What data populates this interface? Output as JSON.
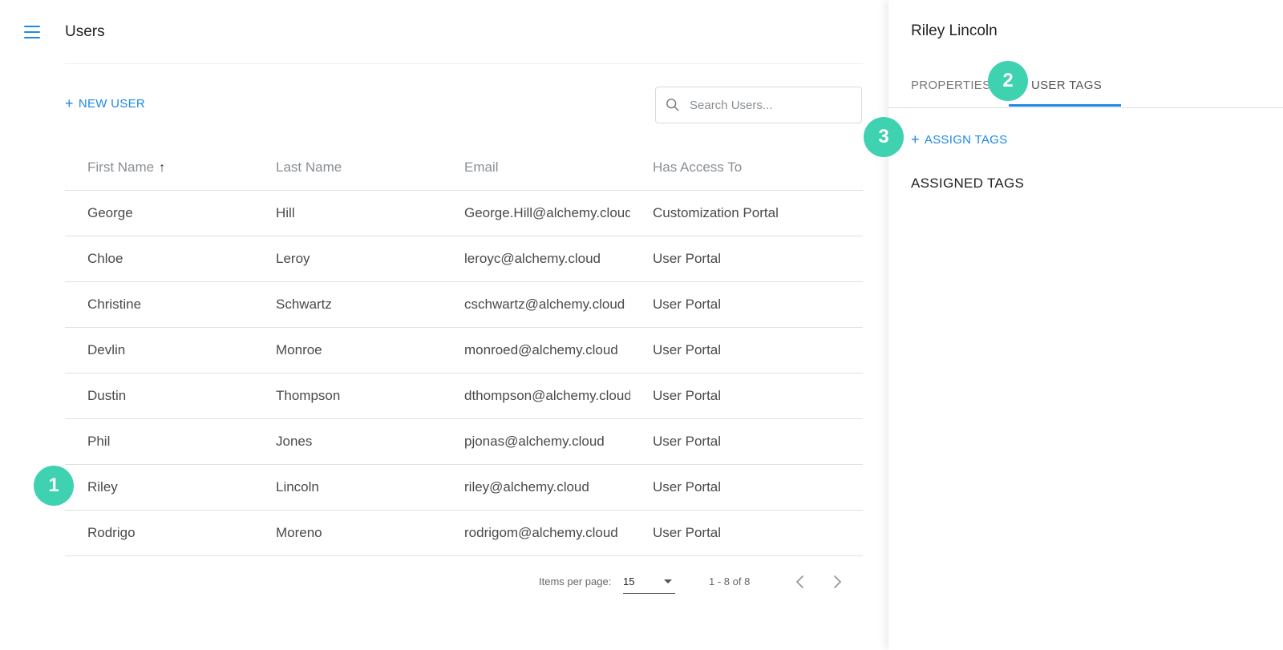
{
  "header": {
    "title": "Users"
  },
  "toolbar": {
    "new_user_label": "NEW USER",
    "search_placeholder": "Search Users..."
  },
  "table": {
    "columns": [
      "First Name",
      "Last Name",
      "Email",
      "Has Access To"
    ],
    "sorted_column": "First Name",
    "sort_direction": "ascending",
    "rows": [
      [
        "George",
        "Hill",
        "George.Hill@alchemy.cloud",
        "Customization Portal"
      ],
      [
        "Chloe",
        "Leroy",
        "leroyc@alchemy.cloud",
        "User Portal"
      ],
      [
        "Christine",
        "Schwartz",
        "cschwartz@alchemy.cloud",
        "User Portal"
      ],
      [
        "Devlin",
        "Monroe",
        "monroed@alchemy.cloud",
        "User Portal"
      ],
      [
        "Dustin",
        "Thompson",
        "dthompson@alchemy.cloud",
        "User Portal"
      ],
      [
        "Phil",
        "Jones",
        "pjonas@alchemy.cloud",
        "User Portal"
      ],
      [
        "Riley",
        "Lincoln",
        "riley@alchemy.cloud",
        "User Portal"
      ],
      [
        "Rodrigo",
        "Moreno",
        "rodrigom@alchemy.cloud",
        "User Portal"
      ]
    ]
  },
  "paginator": {
    "items_per_page_label": "Items per page:",
    "items_per_page": "15",
    "range": "1 - 8 of 8"
  },
  "panel": {
    "title": "Riley Lincoln",
    "tabs": [
      {
        "label": "PROPERTIES"
      },
      {
        "label": "USER TAGS"
      }
    ],
    "active_tab": "USER TAGS",
    "assign_tags_label": "ASSIGN TAGS",
    "assigned_tags_header": "ASSIGNED TAGS"
  },
  "annotations": [
    "1",
    "2",
    "3"
  ],
  "colors": {
    "accent": "#1e88e5",
    "badge": "#3ed2b0"
  },
  "icons": {
    "menu": "hamburger-menu-icon",
    "search": "search-icon",
    "sort": "arrow-up-icon",
    "prev": "chevron-left-icon",
    "next": "chevron-right-icon"
  }
}
